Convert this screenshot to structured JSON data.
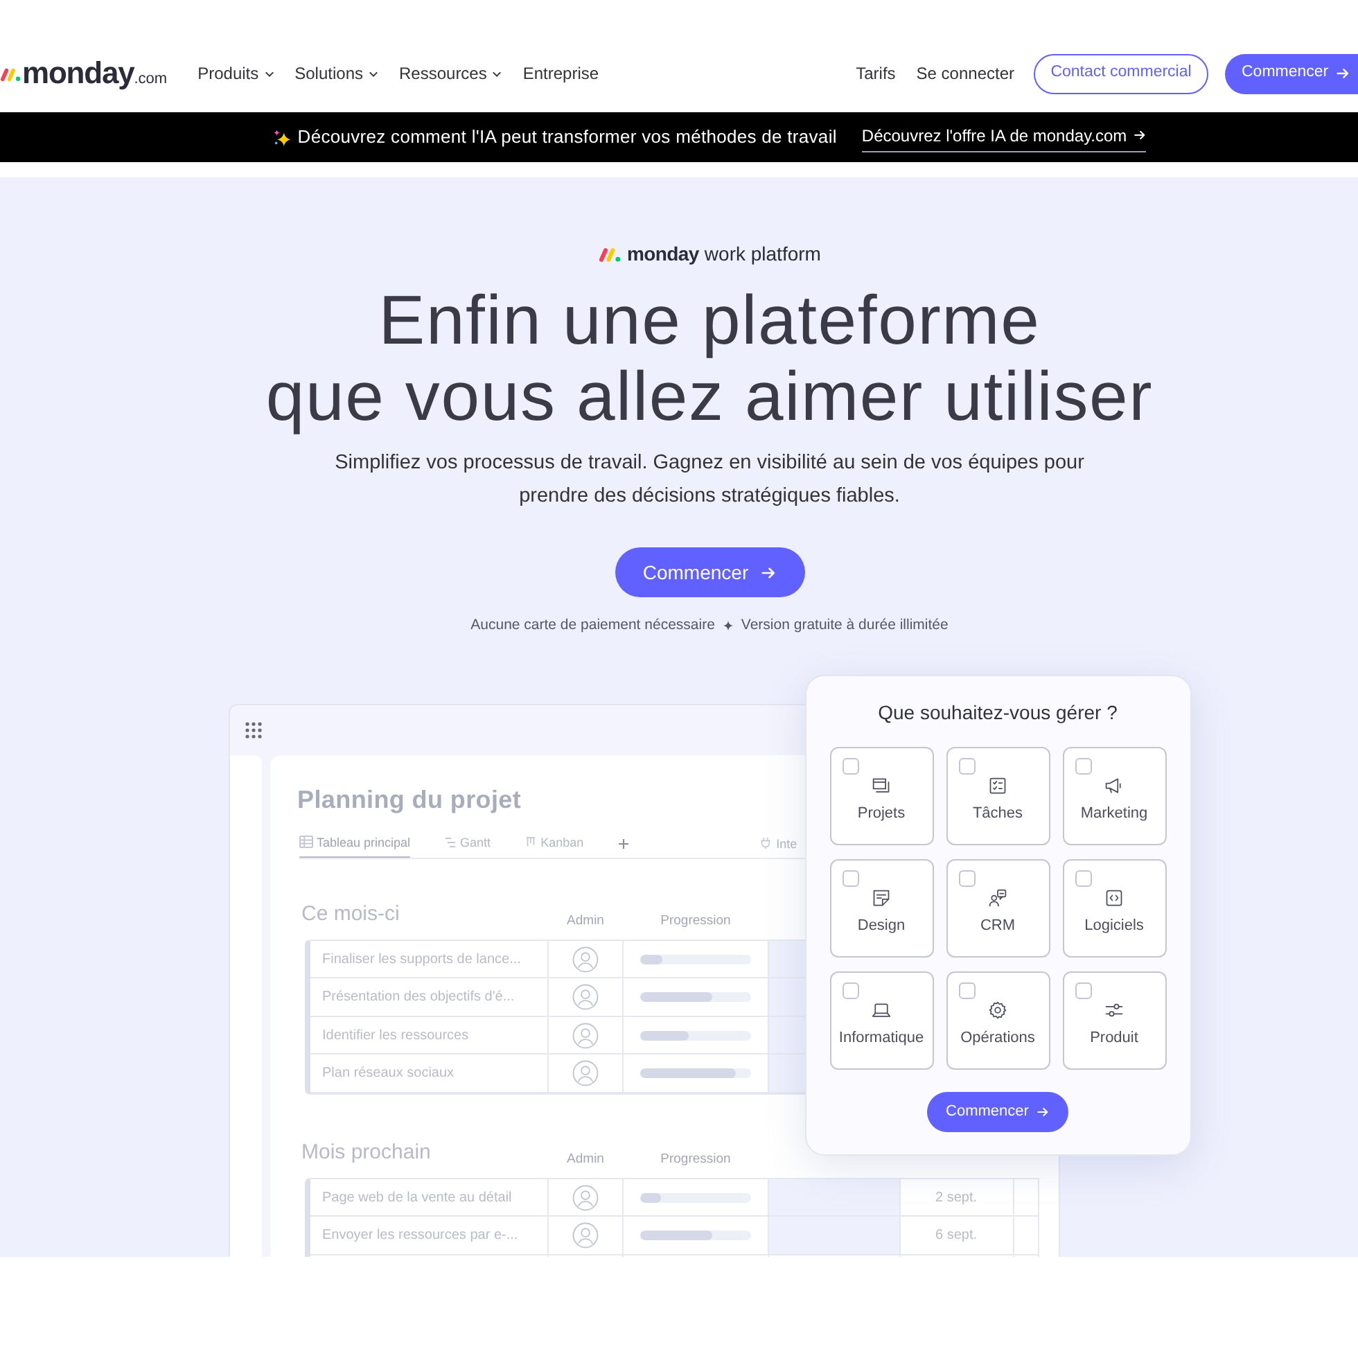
{
  "header": {
    "logo": {
      "name": "monday",
      "suffix": ".com"
    },
    "nav": [
      {
        "label": "Produits",
        "has_menu": true
      },
      {
        "label": "Solutions",
        "has_menu": true
      },
      {
        "label": "Ressources",
        "has_menu": true
      },
      {
        "label": "Entreprise",
        "has_menu": false
      }
    ],
    "links": [
      "Tarifs",
      "Se connecter"
    ],
    "contact_button": "Contact commercial",
    "start_button": "Commencer"
  },
  "banner": {
    "text": "Découvrez comment l'IA peut transformer vos méthodes de travail",
    "link": "Découvrez l'offre IA de monday.com"
  },
  "hero": {
    "brand": {
      "name": "monday",
      "product": "work platform"
    },
    "title": "Enfin une plateforme\nque vous allez aimer utiliser",
    "subtitle": "Simplifiez vos processus de travail. Gagnez en visibilité au sein de vos équipes pour\nprendre des décisions stratégiques fiables.",
    "cta": "Commencer",
    "notes": [
      "Aucune carte de paiement nécessaire",
      "Version gratuite à durée illimitée"
    ]
  },
  "board": {
    "title": "Planning du projet",
    "tabs": [
      {
        "label": "Tableau principal",
        "selected": true
      },
      {
        "label": "Gantt",
        "selected": false
      },
      {
        "label": "Kanban",
        "selected": false
      }
    ],
    "integrations_tab": "Inte",
    "groups": [
      {
        "title": "Ce mois-ci",
        "columns": [
          "Admin",
          "Progression"
        ],
        "rows": [
          {
            "task": "Finaliser les supports de lance...",
            "level": 0.21
          },
          {
            "task": "Présentation des objectifs d'é...",
            "level": 0.65
          },
          {
            "task": "Identifier les ressources",
            "level": 0.44
          },
          {
            "task": "Plan réseaux sociaux",
            "level": 0.87
          }
        ]
      },
      {
        "title": "Mois prochain",
        "columns": [
          "Admin",
          "Progression"
        ],
        "rows": [
          {
            "task": "Page web de la vente au détail",
            "level": 0.19,
            "date": "2 sept."
          },
          {
            "task": "Envoyer les ressources par e-...",
            "level": 0.65,
            "date": "6 sept."
          }
        ]
      }
    ]
  },
  "picker": {
    "title": "Que souhaitez-vous gérer ?",
    "options": [
      {
        "label": "Projets",
        "checked": false
      },
      {
        "label": "Tâches",
        "checked": false
      },
      {
        "label": "Marketing",
        "checked": false
      },
      {
        "label": "Design",
        "checked": false
      },
      {
        "label": "CRM",
        "checked": false
      },
      {
        "label": "Logiciels",
        "checked": false
      },
      {
        "label": "Informatique",
        "checked": false
      },
      {
        "label": "Opérations",
        "checked": false
      },
      {
        "label": "Produit",
        "checked": false
      }
    ],
    "button": "Commencer"
  }
}
